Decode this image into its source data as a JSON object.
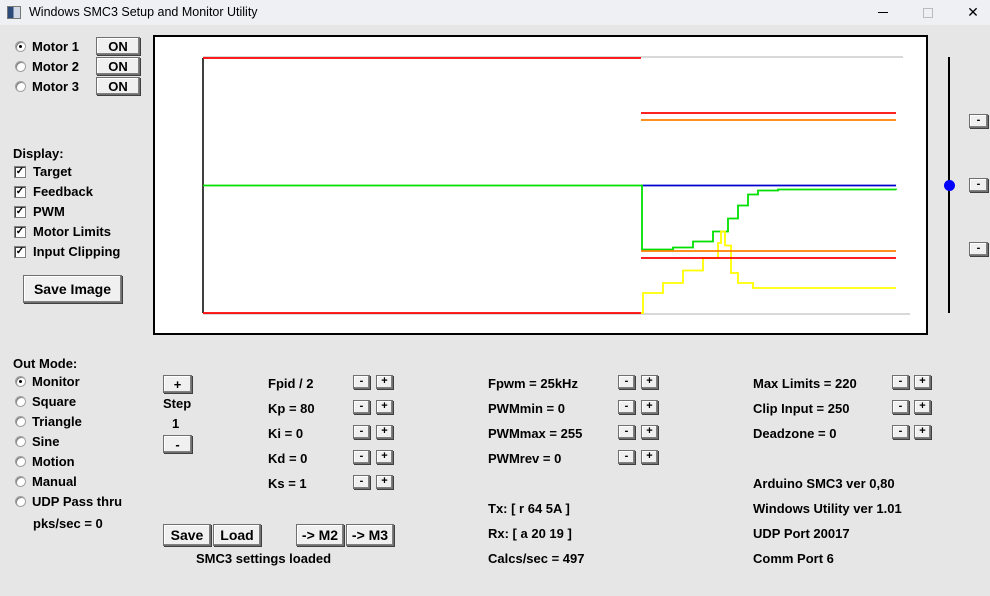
{
  "window": {
    "title": "Windows SMC3 Setup and Monitor Utility",
    "controls": {
      "minimize": "—",
      "maximize": "☐",
      "close": "✕"
    }
  },
  "motors": [
    {
      "label": "Motor 1",
      "selected": true,
      "button": "ON"
    },
    {
      "label": "Motor 2",
      "selected": false,
      "button": "ON"
    },
    {
      "label": "Motor 3",
      "selected": false,
      "button": "ON"
    }
  ],
  "display": {
    "heading": "Display:",
    "options": [
      {
        "label": "Target",
        "checked": true
      },
      {
        "label": "Feedback",
        "checked": true
      },
      {
        "label": "PWM",
        "checked": true
      },
      {
        "label": "Motor Limits",
        "checked": true
      },
      {
        "label": "Input Clipping",
        "checked": true
      }
    ],
    "save_image": "Save Image"
  },
  "out_mode": {
    "heading": "Out Mode:",
    "options": [
      {
        "label": "Monitor",
        "selected": true
      },
      {
        "label": "Square",
        "selected": false
      },
      {
        "label": "Triangle",
        "selected": false
      },
      {
        "label": "Sine",
        "selected": false
      },
      {
        "label": "Motion",
        "selected": false
      },
      {
        "label": "Manual",
        "selected": false
      },
      {
        "label": "UDP Pass thru",
        "selected": false
      }
    ],
    "pks": "pks/sec = 0"
  },
  "step": {
    "plus": "+",
    "label": "Step",
    "value": "1",
    "minus": "-"
  },
  "pid": [
    {
      "label": "Fpid / 2"
    },
    {
      "label": "Kp = 80"
    },
    {
      "label": "Ki = 0"
    },
    {
      "label": "Kd = 0"
    },
    {
      "label": "Ks = 1"
    }
  ],
  "pwm": [
    {
      "label": "Fpwm = 25kHz"
    },
    {
      "label": "PWMmin = 0"
    },
    {
      "label": "PWMmax = 255"
    },
    {
      "label": "PWMrev = 0"
    }
  ],
  "limits": [
    {
      "label": "Max Limits = 220"
    },
    {
      "label": "Clip Input = 250"
    },
    {
      "label": "Deadzone = 0"
    }
  ],
  "adjust": {
    "minus": "-",
    "plus": "+"
  },
  "comms": {
    "tx": "Tx: [ r 64 5A ]",
    "rx": "Rx: [ a 20 19 ]",
    "calcs": "Calcs/sec = 497"
  },
  "info": {
    "arduino": "Arduino SMC3 ver 0,80",
    "utility": "Windows Utility ver 1.01",
    "udp": "UDP Port 20017",
    "comm": "Comm Port 6"
  },
  "actions": {
    "save": "Save",
    "load": "Load",
    "to_m2": "-> M2",
    "to_m3": "-> M3",
    "status": "SMC3 settings loaded"
  },
  "right_panel": {
    "minus_buttons": [
      "-",
      "-",
      "-"
    ],
    "slider_level": 0.5
  },
  "chart_data": {
    "type": "line",
    "title": "",
    "xlabel": "",
    "ylabel": "",
    "x_range": [
      0,
      700
    ],
    "ylim": [
      -255,
      255
    ],
    "colors": {
      "target": "#0000ff",
      "feedback": "#00e000",
      "pwm": "#ffff00",
      "limits": "#ff0000",
      "clipping": "#ff8000"
    },
    "series": [
      {
        "name": "Target",
        "color": "#0000cc",
        "points": [
          [
            438,
            0
          ],
          [
            693,
            0
          ]
        ]
      },
      {
        "name": "Feedback",
        "color": "#00e000",
        "points": [
          [
            0,
            0
          ],
          [
            438,
            0
          ],
          [
            439,
            -128
          ],
          [
            450,
            -128
          ],
          [
            470,
            -124
          ],
          [
            490,
            -112
          ],
          [
            510,
            -92
          ],
          [
            525,
            -66
          ],
          [
            535,
            -40
          ],
          [
            545,
            -18
          ],
          [
            555,
            -10
          ],
          [
            575,
            -8
          ],
          [
            693,
            -9
          ]
        ]
      },
      {
        "name": "PWM",
        "color": "#ffff00",
        "points": [
          [
            438,
            -255
          ],
          [
            440,
            -215
          ],
          [
            460,
            -195
          ],
          [
            480,
            -170
          ],
          [
            500,
            -145
          ],
          [
            515,
            -115
          ],
          [
            518,
            -92
          ],
          [
            520,
            -92
          ],
          [
            522,
            -120
          ],
          [
            528,
            -175
          ],
          [
            535,
            -195
          ],
          [
            550,
            -205
          ],
          [
            693,
            -205
          ]
        ]
      },
      {
        "name": "Motor Limits",
        "color": "#ff0000",
        "segments": [
          [
            [
              0,
              255
            ],
            [
              438,
              255
            ]
          ],
          [
            [
              0,
              -255
            ],
            [
              438,
              -255
            ]
          ],
          [
            [
              438,
              145
            ],
            [
              693,
              145
            ]
          ],
          [
            [
              438,
              -145
            ],
            [
              693,
              -145
            ]
          ]
        ]
      },
      {
        "name": "Input Clipping",
        "color": "#ff8000",
        "segments": [
          [
            [
              438,
              131
            ],
            [
              693,
              131
            ]
          ],
          [
            [
              438,
              -131
            ],
            [
              693,
              -131
            ]
          ]
        ]
      }
    ]
  }
}
